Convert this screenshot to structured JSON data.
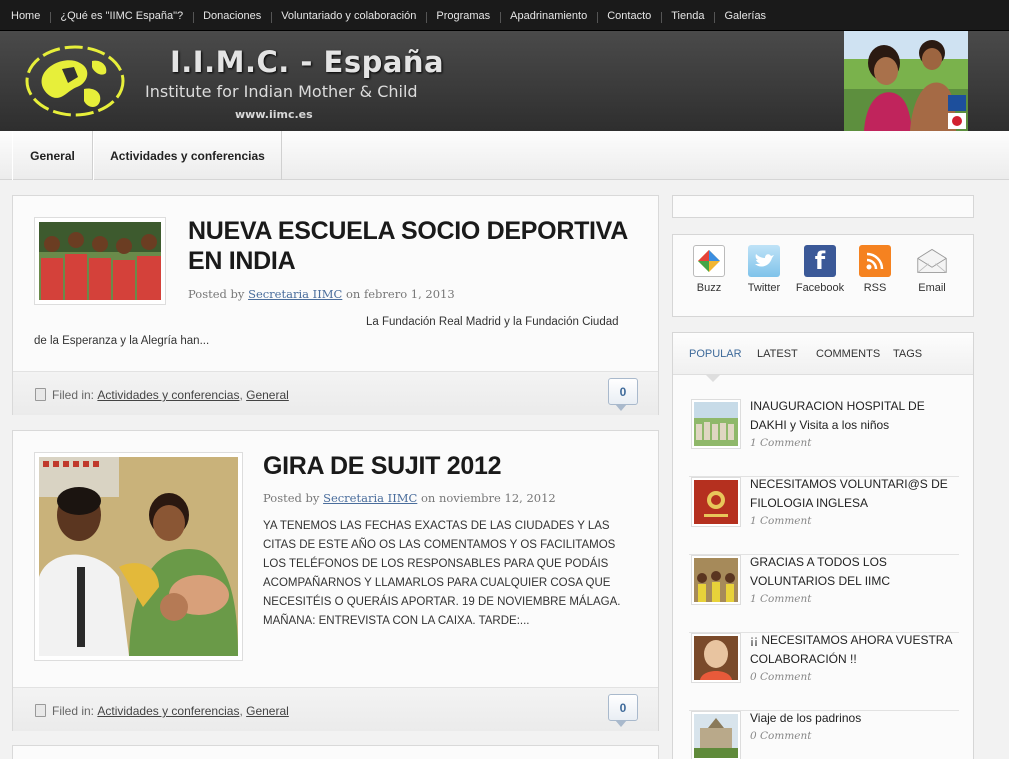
{
  "topnav": {
    "items": [
      "Home",
      "¿Qué es \"IIMC España\"?",
      "Donaciones",
      "Voluntariado y colaboración",
      "Programas",
      "Apadrinamiento",
      "Contacto",
      "Tienda",
      "Galerías"
    ]
  },
  "header": {
    "title": "I.I.M.C. - España",
    "subtitle": "Institute for Indian Mother & Child",
    "url": "www.iimc.es"
  },
  "catnav": {
    "tabs": [
      "General",
      "Actividades y conferencias"
    ]
  },
  "posts": [
    {
      "title_line1": "NUEVA ESCUELA SOCIO DEPORTIVA",
      "title_line2": "EN INDIA",
      "posted_by": "Posted by",
      "author": "Secretaria IIMC",
      "date": "on febrero 1, 2013",
      "excerpt_line1": "La Fundación Real Madrid y la Fundación Ciudad",
      "excerpt_line2": "de la Esperanza y la Alegría han...",
      "filed_in": "Filed in:",
      "cat1": "Actividades y conferencias",
      "cat2": "General",
      "comments": "0"
    },
    {
      "title": "GIRA DE SUJIT 2012",
      "posted_by": "Posted by",
      "author": "Secretaria IIMC",
      "date": "on noviembre 12, 2012",
      "excerpt_lines": [
        "YA TENEMOS  LAS FECHAS EXACTAS DE LAS CIUDADES Y LAS",
        "CITAS DE ESTE AÑO OS LAS COMENTAMOS Y OS FACILITAMOS",
        "LOS TELÉFONOS DE LOS RESPONSABLES PARA QUE PODÁIS",
        "ACOMPAÑARNOS Y LLAMARLOS PARA CUALQUIER COSA QUE",
        "NECESITÉIS O QUERÁIS APORTAR. 19 DE NOVIEMBRE MÁLAGA.",
        "MAÑANA: ENTREVISTA CON LA CAIXA. TARDE:..."
      ],
      "filed_in": "Filed in:",
      "cat1": "Actividades y conferencias",
      "cat2": "General",
      "comments": "0"
    }
  ],
  "social": [
    {
      "label": "Buzz",
      "icon": "buzz-icon",
      "color": "#f2b632"
    },
    {
      "label": "Twitter",
      "icon": "twitter-icon",
      "color": "#62b4e3"
    },
    {
      "label": "Facebook",
      "icon": "facebook-icon",
      "color": "#3b5998"
    },
    {
      "label": "RSS",
      "icon": "rss-icon",
      "color": "#f58220"
    },
    {
      "label": "Email",
      "icon": "email-icon",
      "color": "#dcdcdc"
    }
  ],
  "tabs": [
    "POPULAR",
    "LATEST",
    "COMMENTS",
    "TAGS"
  ],
  "popular": [
    {
      "title_lines": [
        "INAUGURACION HOSPITAL DE",
        "DAKHI y Visita a los niños"
      ],
      "count": "1 Comment"
    },
    {
      "title_lines": [
        "NECESITAMOS VOLUNTARI@S DE",
        "FILOLOGIA INGLESA"
      ],
      "count": "1 Comment"
    },
    {
      "title_lines": [
        "GRACIAS A TODOS LOS",
        "VOLUNTARIOS DEL IIMC"
      ],
      "count": "1 Comment"
    },
    {
      "title_lines": [
        "¡¡ NECESITAMOS AHORA VUESTRA",
        "COLABORACIÓN !!"
      ],
      "count": "0 Comment"
    },
    {
      "title_lines": [
        "Viaje de los padrinos"
      ],
      "count": "0 Comment"
    }
  ],
  "colors": {
    "accent": "#3e6a9a",
    "topnav_bg": "#1a1a1a",
    "header_bg": "#3a3a3a"
  }
}
